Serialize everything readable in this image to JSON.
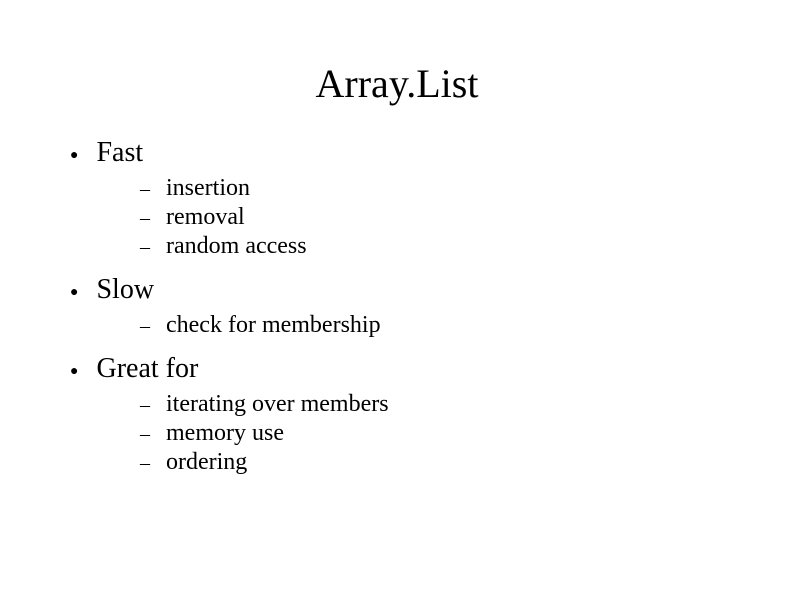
{
  "title": "Array.List",
  "sections": [
    {
      "label": "Fast",
      "items": [
        "insertion",
        "removal",
        "random access"
      ]
    },
    {
      "label": "Slow",
      "items": [
        "check for membership"
      ]
    },
    {
      "label": "Great for",
      "items": [
        "iterating over members",
        "memory use",
        "ordering"
      ]
    }
  ]
}
